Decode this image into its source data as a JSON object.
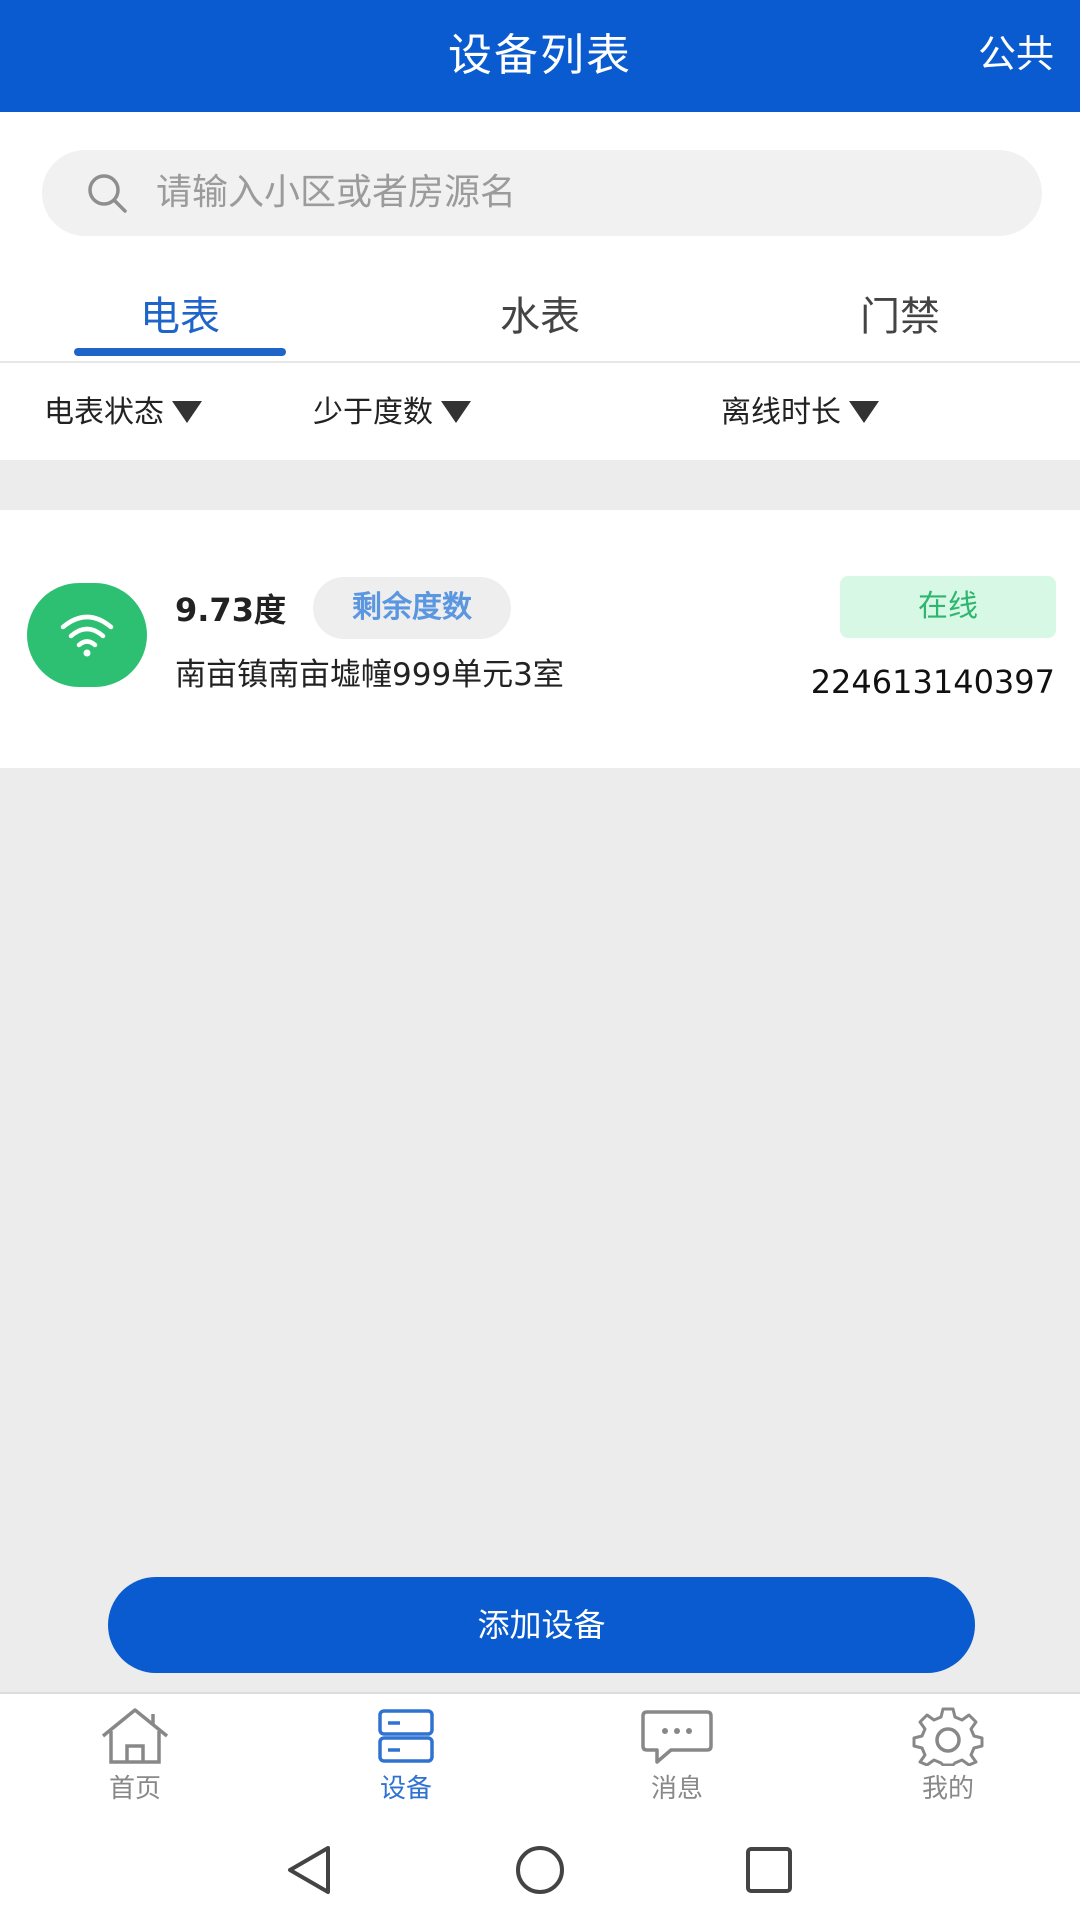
{
  "header": {
    "title": "设备列表",
    "right_action": "公共"
  },
  "search": {
    "placeholder": "请输入小区或者房源名"
  },
  "tabs": [
    {
      "label": "电表",
      "active": true
    },
    {
      "label": "水表",
      "active": false
    },
    {
      "label": "门禁",
      "active": false
    }
  ],
  "filters": [
    {
      "label": "电表状态"
    },
    {
      "label": "少于度数"
    },
    {
      "label": "离线时长"
    }
  ],
  "device": {
    "reading": "9.73度",
    "badge": "剩余度数",
    "address": "南亩镇南亩墟幢999单元3室",
    "status": "在线",
    "id": "224613140397"
  },
  "add_button": "添加设备",
  "nav": [
    {
      "label": "首页",
      "icon": "home-icon",
      "active": false
    },
    {
      "label": "设备",
      "icon": "device-icon",
      "active": true
    },
    {
      "label": "消息",
      "icon": "message-icon",
      "active": false
    },
    {
      "label": "我的",
      "icon": "gear-icon",
      "active": false
    }
  ],
  "colors": {
    "primary": "#0a5bd0",
    "online_green": "#2dc073",
    "online_badge_bg": "#d8f8e6"
  }
}
